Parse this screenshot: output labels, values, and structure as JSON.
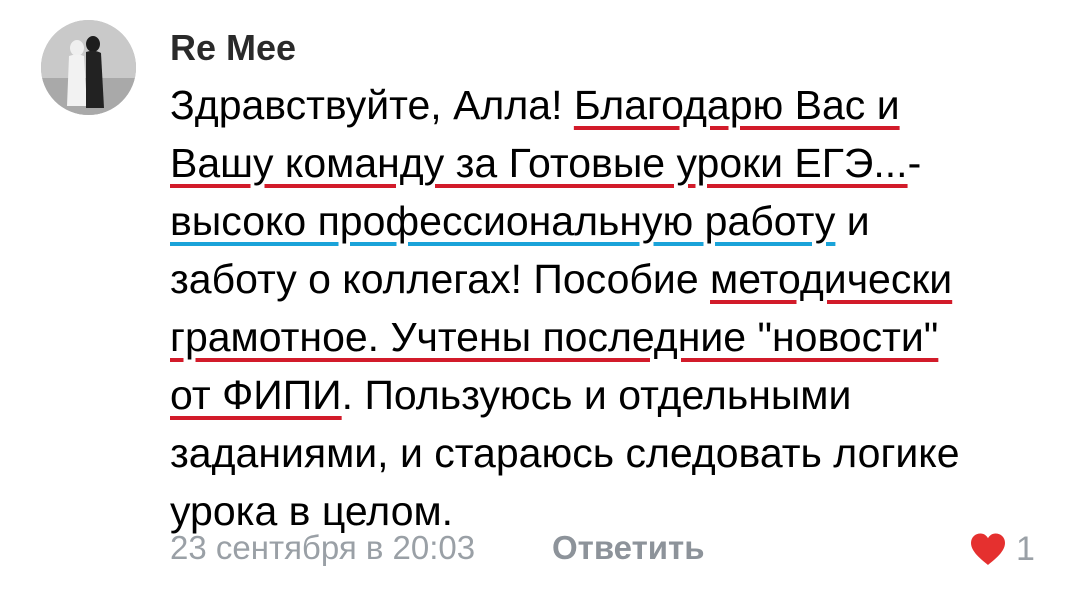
{
  "comment": {
    "author": "Re Mee",
    "text_lines": [
      [
        {
          "text": "Здравствуйте, Алла! ",
          "mark": "none"
        },
        {
          "text": "Благодарю Вас и",
          "mark": "red"
        }
      ],
      [
        {
          "text": "Вашу команду за Готовые уроки ЕГЭ...",
          "mark": "red"
        },
        {
          "text": "-",
          "mark": "none"
        }
      ],
      [
        {
          "text": "высоко профессиональную работу",
          "mark": "blue"
        },
        {
          "text": " и",
          "mark": "none"
        }
      ],
      [
        {
          "text": "заботу о коллегах! Пособие ",
          "mark": "none"
        },
        {
          "text": "методически",
          "mark": "red"
        }
      ],
      [
        {
          "text": "грамотное. Учтены последние \"новости\"",
          "mark": "red"
        }
      ],
      [
        {
          "text": "от ФИПИ",
          "mark": "red"
        },
        {
          "text": ". Пользуюсь и отдельными",
          "mark": "none"
        }
      ],
      [
        {
          "text": "заданиями, и стараюсь следовать логике",
          "mark": "none"
        }
      ],
      [
        {
          "text": "урока в целом.",
          "mark": "none"
        }
      ]
    ],
    "timestamp": "23 сентября в 20:03",
    "reply_label": "Ответить",
    "like_count": "1"
  },
  "colors": {
    "underline_red": "#d21b2a",
    "underline_blue": "#1aa3d9",
    "heart": "#e5302f",
    "meta_text": "#9aa0a6"
  },
  "icons": {
    "like": "heart-icon"
  }
}
